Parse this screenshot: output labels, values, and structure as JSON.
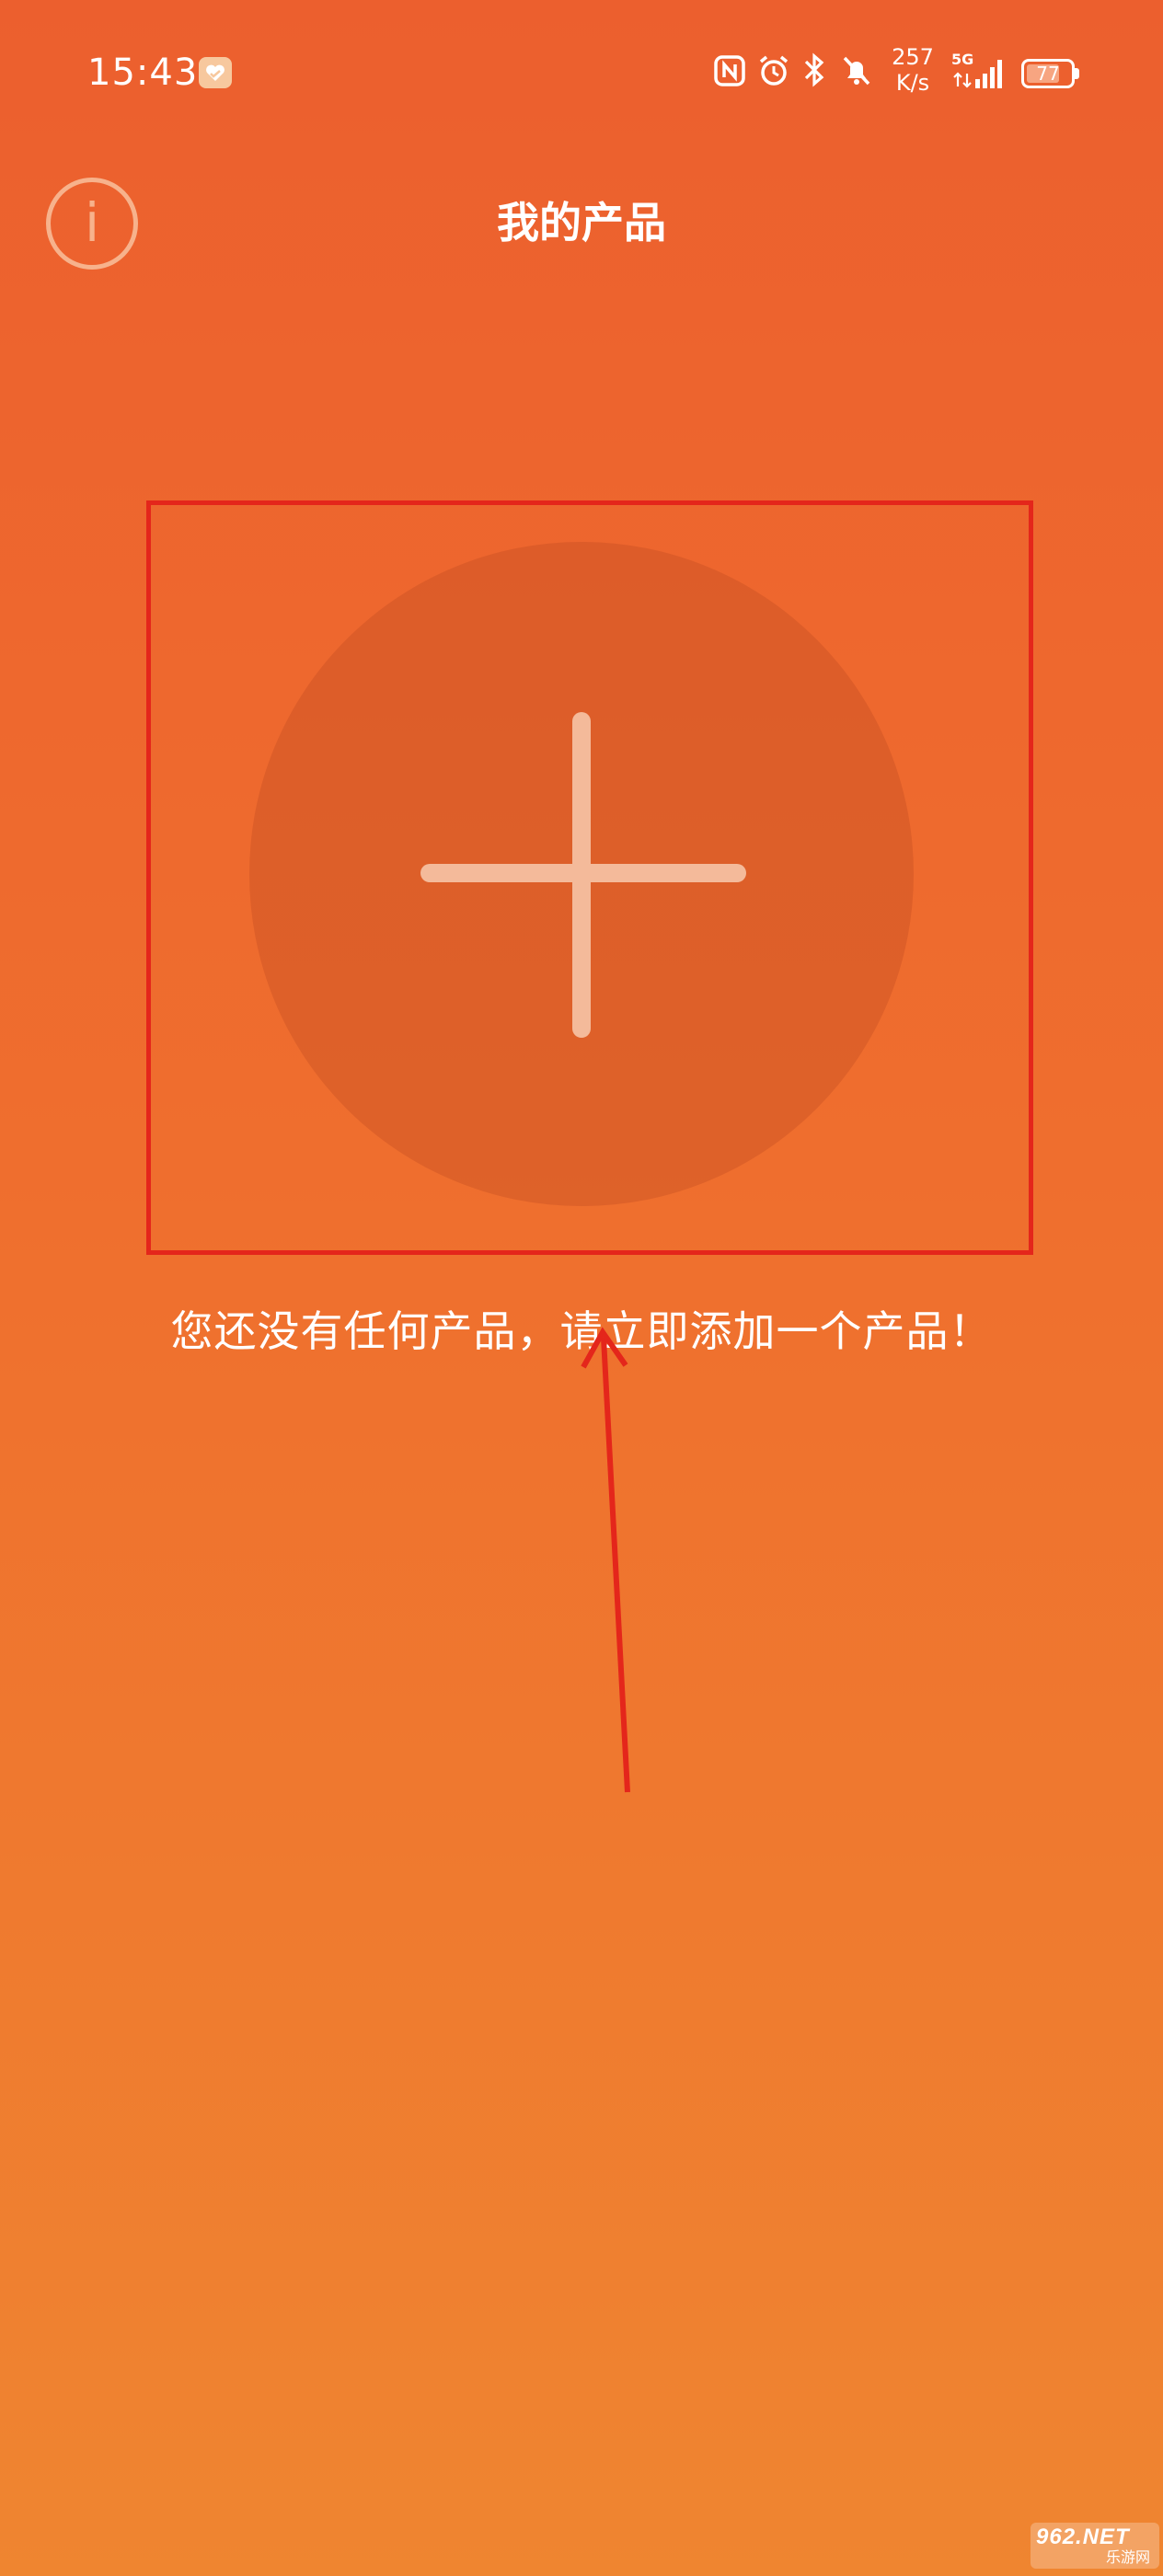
{
  "status_bar": {
    "time": "15:43",
    "net_speed_value": "257",
    "net_speed_unit": "K/s",
    "network_type": "5G",
    "battery_level": "77",
    "battery_fraction": 0.77,
    "icons": [
      "health-icon",
      "nfc-icon",
      "alarm-icon",
      "bluetooth-icon",
      "mute-icon",
      "signal-icon",
      "battery-icon"
    ]
  },
  "header": {
    "info_icon": "ⓘ",
    "info_glyph": "i",
    "title": "我的产品"
  },
  "main": {
    "add_icon": "plus-icon",
    "empty_message": "您还没有任何产品，请立即添加一个产品！"
  },
  "watermark": {
    "brand": "962.NET",
    "subtitle": "乐游网"
  },
  "colors": {
    "background_top": "#EC5F2E",
    "background_bottom": "#EF8530",
    "annotation": "#E4261B",
    "plus": "#F4BA9A"
  }
}
